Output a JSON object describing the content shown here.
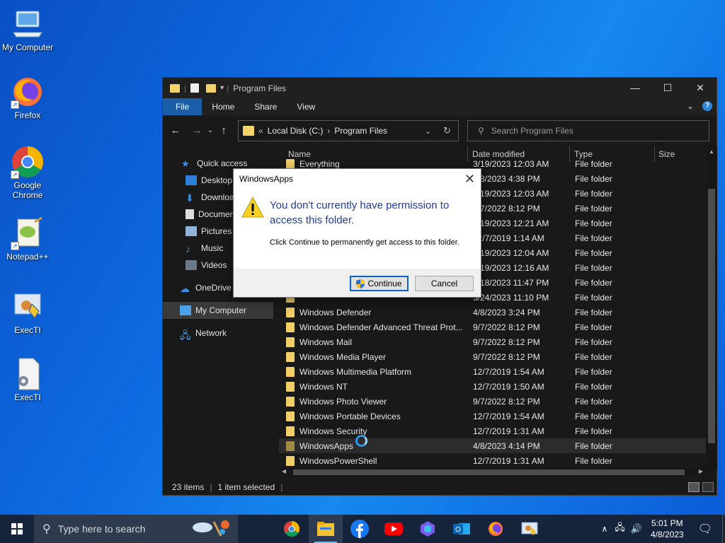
{
  "desktop": {
    "icons": [
      {
        "label": "My Computer",
        "icon": "computer-icon"
      },
      {
        "label": "Firefox",
        "icon": "firefox-icon"
      },
      {
        "label": "Google Chrome",
        "icon": "chrome-icon"
      },
      {
        "label": "Notepad++",
        "icon": "notepadpp-icon"
      },
      {
        "label": "ExecTI",
        "icon": "execti-icon"
      },
      {
        "label": "ExecTI",
        "icon": "execti-file-icon"
      }
    ]
  },
  "explorer": {
    "title": "Program Files",
    "ribbon_tabs": [
      "File",
      "Home",
      "Share",
      "View"
    ],
    "address": {
      "root": "Local Disk (C:)",
      "current": "Program Files"
    },
    "search_placeholder": "Search Program Files",
    "columns": {
      "name": "Name",
      "date": "Date modified",
      "type": "Type",
      "size": "Size"
    },
    "nav": {
      "quick_access": "Quick access",
      "desktop": "Desktop",
      "downloads": "Downloads",
      "documents": "Documents",
      "pictures": "Pictures",
      "music": "Music",
      "videos": "Videos",
      "onedrive": "OneDrive",
      "my_computer": "My Computer",
      "network": "Network"
    },
    "files": [
      {
        "name": "Everything",
        "date": "3/19/2023 12:03 AM",
        "type": "File folder"
      },
      {
        "name": "",
        "date": "4/8/2023 4:38 PM",
        "type": "File folder"
      },
      {
        "name": "",
        "date": "3/19/2023 12:03 AM",
        "type": "File folder"
      },
      {
        "name": "",
        "date": "9/7/2022 8:12 PM",
        "type": "File folder"
      },
      {
        "name": "",
        "date": "3/19/2023 12:21 AM",
        "type": "File folder"
      },
      {
        "name": "",
        "date": "12/7/2019 1:14 AM",
        "type": "File folder"
      },
      {
        "name": "",
        "date": "3/19/2023 12:04 AM",
        "type": "File folder"
      },
      {
        "name": "",
        "date": "3/19/2023 12:16 AM",
        "type": "File folder"
      },
      {
        "name": "",
        "date": "3/18/2023 11:47 PM",
        "type": "File folder"
      },
      {
        "name": "",
        "date": "3/24/2023 11:10 PM",
        "type": "File folder"
      },
      {
        "name": "Windows Defender",
        "date": "4/8/2023 3:24 PM",
        "type": "File folder"
      },
      {
        "name": "Windows Defender Advanced Threat Prot...",
        "date": "9/7/2022 8:12 PM",
        "type": "File folder"
      },
      {
        "name": "Windows Mail",
        "date": "9/7/2022 8:12 PM",
        "type": "File folder"
      },
      {
        "name": "Windows Media Player",
        "date": "9/7/2022 8:12 PM",
        "type": "File folder"
      },
      {
        "name": "Windows Multimedia Platform",
        "date": "12/7/2019 1:54 AM",
        "type": "File folder"
      },
      {
        "name": "Windows NT",
        "date": "12/7/2019 1:50 AM",
        "type": "File folder"
      },
      {
        "name": "Windows Photo Viewer",
        "date": "9/7/2022 8:12 PM",
        "type": "File folder"
      },
      {
        "name": "Windows Portable Devices",
        "date": "12/7/2019 1:54 AM",
        "type": "File folder"
      },
      {
        "name": "Windows Security",
        "date": "12/7/2019 1:31 AM",
        "type": "File folder"
      },
      {
        "name": "WindowsApps",
        "date": "4/8/2023 4:14 PM",
        "type": "File folder",
        "selected": true
      },
      {
        "name": "WindowsPowerShell",
        "date": "12/7/2019 1:31 AM",
        "type": "File folder"
      }
    ],
    "status": {
      "items": "23 items",
      "selected": "1 item selected"
    }
  },
  "dialog": {
    "title": "WindowsApps",
    "main_text": "You don't currently have permission to access this folder.",
    "sub_text": "Click Continue to permanently get access to this folder.",
    "continue_label": "Continue",
    "cancel_label": "Cancel"
  },
  "taskbar": {
    "search_placeholder": "Type here to search",
    "time": "5:01 PM",
    "date": "4/8/2023",
    "apps": [
      "chrome-icon",
      "file-explorer-icon",
      "facebook-icon",
      "youtube-icon",
      "copilot-icon",
      "outlook-icon",
      "firefox-icon",
      "execti-icon"
    ]
  },
  "colors": {
    "accent": "#1a5ea8",
    "dialog_heading": "#1f3d9c",
    "folder": "#f2cf66"
  }
}
